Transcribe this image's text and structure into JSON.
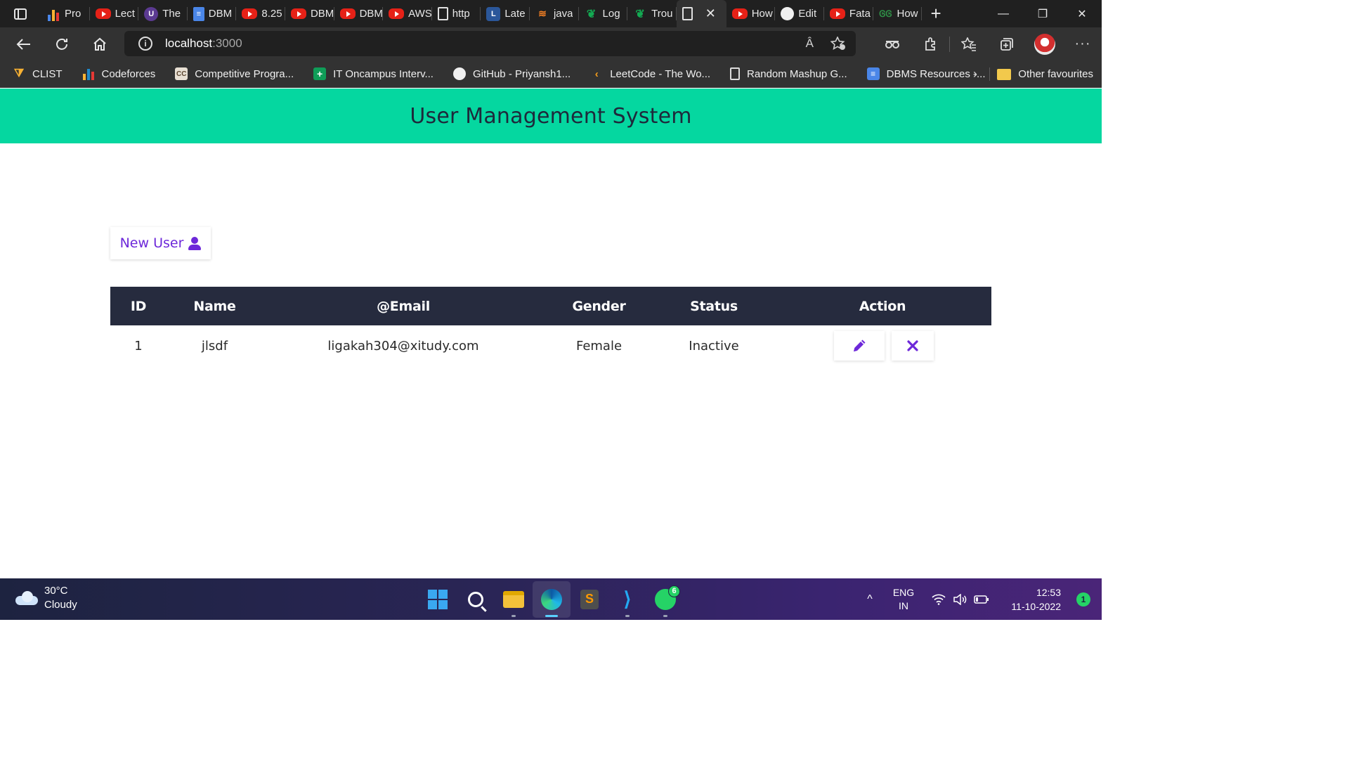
{
  "browser": {
    "tabs": [
      {
        "title": "Pro",
        "icon": "bar-chart-icon"
      },
      {
        "title": "Lect",
        "icon": "youtube-icon"
      },
      {
        "title": "The",
        "icon": "university-icon"
      },
      {
        "title": "DBM",
        "icon": "google-docs-icon"
      },
      {
        "title": "8.25",
        "icon": "youtube-icon"
      },
      {
        "title": "DBM",
        "icon": "youtube-icon"
      },
      {
        "title": "DBM",
        "icon": "youtube-icon"
      },
      {
        "title": "AWS",
        "icon": "youtube-icon"
      },
      {
        "title": "http",
        "icon": "file-icon"
      },
      {
        "title": "Late",
        "icon": "site-icon"
      },
      {
        "title": "java",
        "icon": "stackoverflow-icon"
      },
      {
        "title": "Log",
        "icon": "mongodb-icon"
      },
      {
        "title": "Trou",
        "icon": "mongodb-icon"
      },
      {
        "title": "",
        "icon": "file-icon",
        "active": true
      },
      {
        "title": "How",
        "icon": "youtube-icon"
      },
      {
        "title": "Edit",
        "icon": "github-icon"
      },
      {
        "title": "Fata",
        "icon": "youtube-icon"
      },
      {
        "title": "How",
        "icon": "geeksforgeeks-icon"
      }
    ],
    "active_tab_close": "✕",
    "new_tab": "+",
    "window_controls": {
      "minimize": "—",
      "restore": "❐",
      "close": "✕"
    },
    "address": {
      "host": "localhost",
      "port": ":3000"
    },
    "read_aloud": "Â",
    "bookmarks": [
      {
        "label": "CLIST",
        "icon": "clist-icon",
        "color": "#f9b233"
      },
      {
        "label": "Codeforces",
        "icon": "codeforces-icon",
        "color": "#1f8acb"
      },
      {
        "label": "Competitive Progra...",
        "icon": "cc-icon",
        "color": "#8a6d4b"
      },
      {
        "label": "IT Oncampus Interv...",
        "icon": "sheets-icon",
        "color": "#0f9d58"
      },
      {
        "label": "GitHub - Priyansh1...",
        "icon": "github-icon",
        "color": "#f0f0f0"
      },
      {
        "label": "LeetCode - The Wo...",
        "icon": "leetcode-icon",
        "color": "#f89f1b"
      },
      {
        "label": "Random Mashup G...",
        "icon": "file-icon",
        "color": "#dcdcdc"
      },
      {
        "label": "DBMS Resources -...",
        "icon": "google-docs-icon",
        "color": "#4a86e8"
      }
    ],
    "bookmarks_more": "›",
    "other_favourites": "Other favourites"
  },
  "app": {
    "title": "User Management System",
    "new_user_label": "New User",
    "table": {
      "columns": [
        "ID",
        "Name",
        "@Email",
        "Gender",
        "Status",
        "Action"
      ],
      "rows": [
        {
          "id": "1",
          "name": "jlsdf",
          "email": "ligakah304@xitudy.com",
          "gender": "Female",
          "status": "Inactive"
        }
      ]
    }
  },
  "taskbar": {
    "weather_temp": "30°C",
    "weather_desc": "Cloudy",
    "whatsapp_badge": "6",
    "tray_chevron": "^",
    "lang_line1": "ENG",
    "lang_line2": "IN",
    "time": "12:53",
    "date": "11-10-2022",
    "notifications": "1"
  },
  "colors": {
    "header_bg": "#05d7a0",
    "table_header_bg": "#262b3e",
    "accent_purple": "#6d28d9"
  }
}
